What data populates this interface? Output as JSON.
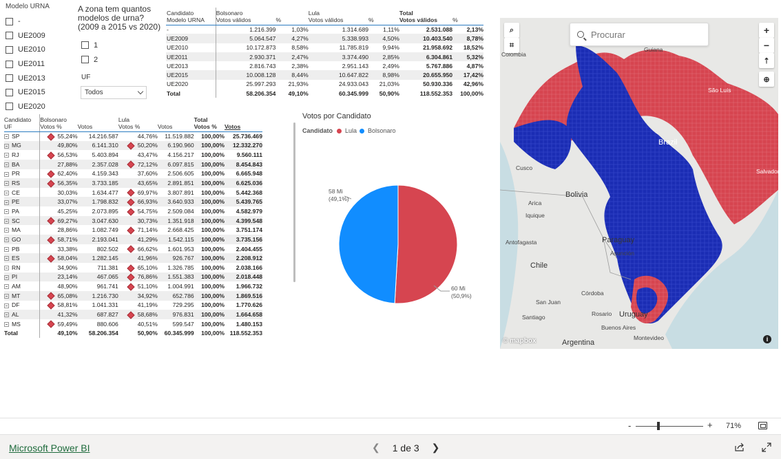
{
  "slicer_urna": {
    "title": "Modelo URNA",
    "options": [
      "-",
      "UE2009",
      "UE2010",
      "UE2011",
      "UE2013",
      "UE2015",
      "UE2020"
    ]
  },
  "slicer_zona": {
    "question": "A zona tem quantos modelos de urna? (2009 a 2015 vs 2020)",
    "options": [
      "1",
      "2"
    ],
    "uf_label": "UF",
    "uf_value": "Todos"
  },
  "table1": {
    "headers_row1": [
      "Candidato",
      "Bolsonaro",
      "",
      "Lula",
      "",
      "Total",
      ""
    ],
    "headers_row2": [
      "Modelo URNA",
      "Votos válidos",
      "%",
      "Votos válidos",
      "%",
      "Votos válidos",
      "%"
    ],
    "rows": [
      [
        "-",
        "1.216.399",
        "1,03%",
        "1.314.689",
        "1,11%",
        "2.531.088",
        "2,13%"
      ],
      [
        "UE2009",
        "5.064.547",
        "4,27%",
        "5.338.993",
        "4,50%",
        "10.403.540",
        "8,78%"
      ],
      [
        "UE2010",
        "10.172.873",
        "8,58%",
        "11.785.819",
        "9,94%",
        "21.958.692",
        "18,52%"
      ],
      [
        "UE2011",
        "2.930.371",
        "2,47%",
        "3.374.490",
        "2,85%",
        "6.304.861",
        "5,32%"
      ],
      [
        "UE2013",
        "2.816.743",
        "2,38%",
        "2.951.143",
        "2,49%",
        "5.767.886",
        "4,87%"
      ],
      [
        "UE2015",
        "10.008.128",
        "8,44%",
        "10.647.822",
        "8,98%",
        "20.655.950",
        "17,42%"
      ],
      [
        "UE2020",
        "25.997.293",
        "21,93%",
        "24.933.043",
        "21,03%",
        "50.930.336",
        "42,96%"
      ]
    ],
    "total": [
      "Total",
      "58.206.354",
      "49,10%",
      "60.345.999",
      "50,90%",
      "118.552.353",
      "100,00%"
    ]
  },
  "table2": {
    "headers_row1": [
      "Candidato",
      "Bolsonaro",
      "",
      "Lula",
      "",
      "Total",
      ""
    ],
    "headers_row2": [
      "UF",
      "Votos %",
      "Votos",
      "Votos %",
      "Votos",
      "Votos %",
      "Votos"
    ],
    "rows": [
      {
        "uf": "SP",
        "b_pct": "55,24%",
        "b_votos": "14.216.587",
        "l_pct": "44,76%",
        "l_votos": "11.519.882",
        "t_pct": "100,00%",
        "t_votos": "25.736.469",
        "win": "b"
      },
      {
        "uf": "MG",
        "b_pct": "49,80%",
        "b_votos": "6.141.310",
        "l_pct": "50,20%",
        "l_votos": "6.190.960",
        "t_pct": "100,00%",
        "t_votos": "12.332.270",
        "win": "l"
      },
      {
        "uf": "RJ",
        "b_pct": "56,53%",
        "b_votos": "5.403.894",
        "l_pct": "43,47%",
        "l_votos": "4.156.217",
        "t_pct": "100,00%",
        "t_votos": "9.560.111",
        "win": "b"
      },
      {
        "uf": "BA",
        "b_pct": "27,88%",
        "b_votos": "2.357.028",
        "l_pct": "72,12%",
        "l_votos": "6.097.815",
        "t_pct": "100,00%",
        "t_votos": "8.454.843",
        "win": "l"
      },
      {
        "uf": "PR",
        "b_pct": "62,40%",
        "b_votos": "4.159.343",
        "l_pct": "37,60%",
        "l_votos": "2.506.605",
        "t_pct": "100,00%",
        "t_votos": "6.665.948",
        "win": "b"
      },
      {
        "uf": "RS",
        "b_pct": "56,35%",
        "b_votos": "3.733.185",
        "l_pct": "43,65%",
        "l_votos": "2.891.851",
        "t_pct": "100,00%",
        "t_votos": "6.625.036",
        "win": "b"
      },
      {
        "uf": "CE",
        "b_pct": "30,03%",
        "b_votos": "1.634.477",
        "l_pct": "69,97%",
        "l_votos": "3.807.891",
        "t_pct": "100,00%",
        "t_votos": "5.442.368",
        "win": "l"
      },
      {
        "uf": "PE",
        "b_pct": "33,07%",
        "b_votos": "1.798.832",
        "l_pct": "66,93%",
        "l_votos": "3.640.933",
        "t_pct": "100,00%",
        "t_votos": "5.439.765",
        "win": "l"
      },
      {
        "uf": "PA",
        "b_pct": "45,25%",
        "b_votos": "2.073.895",
        "l_pct": "54,75%",
        "l_votos": "2.509.084",
        "t_pct": "100,00%",
        "t_votos": "4.582.979",
        "win": "l"
      },
      {
        "uf": "SC",
        "b_pct": "69,27%",
        "b_votos": "3.047.630",
        "l_pct": "30,73%",
        "l_votos": "1.351.918",
        "t_pct": "100,00%",
        "t_votos": "4.399.548",
        "win": "b"
      },
      {
        "uf": "MA",
        "b_pct": "28,86%",
        "b_votos": "1.082.749",
        "l_pct": "71,14%",
        "l_votos": "2.668.425",
        "t_pct": "100,00%",
        "t_votos": "3.751.174",
        "win": "l"
      },
      {
        "uf": "GO",
        "b_pct": "58,71%",
        "b_votos": "2.193.041",
        "l_pct": "41,29%",
        "l_votos": "1.542.115",
        "t_pct": "100,00%",
        "t_votos": "3.735.156",
        "win": "b"
      },
      {
        "uf": "PB",
        "b_pct": "33,38%",
        "b_votos": "802.502",
        "l_pct": "66,62%",
        "l_votos": "1.601.953",
        "t_pct": "100,00%",
        "t_votos": "2.404.455",
        "win": "l"
      },
      {
        "uf": "ES",
        "b_pct": "58,04%",
        "b_votos": "1.282.145",
        "l_pct": "41,96%",
        "l_votos": "926.767",
        "t_pct": "100,00%",
        "t_votos": "2.208.912",
        "win": "b"
      },
      {
        "uf": "RN",
        "b_pct": "34,90%",
        "b_votos": "711.381",
        "l_pct": "65,10%",
        "l_votos": "1.326.785",
        "t_pct": "100,00%",
        "t_votos": "2.038.166",
        "win": "l"
      },
      {
        "uf": "PI",
        "b_pct": "23,14%",
        "b_votos": "467.065",
        "l_pct": "76,86%",
        "l_votos": "1.551.383",
        "t_pct": "100,00%",
        "t_votos": "2.018.448",
        "win": "l"
      },
      {
        "uf": "AM",
        "b_pct": "48,90%",
        "b_votos": "961.741",
        "l_pct": "51,10%",
        "l_votos": "1.004.991",
        "t_pct": "100,00%",
        "t_votos": "1.966.732",
        "win": "l"
      },
      {
        "uf": "MT",
        "b_pct": "65,08%",
        "b_votos": "1.216.730",
        "l_pct": "34,92%",
        "l_votos": "652.786",
        "t_pct": "100,00%",
        "t_votos": "1.869.516",
        "win": "b"
      },
      {
        "uf": "DF",
        "b_pct": "58,81%",
        "b_votos": "1.041.331",
        "l_pct": "41,19%",
        "l_votos": "729.295",
        "t_pct": "100,00%",
        "t_votos": "1.770.626",
        "win": "b"
      },
      {
        "uf": "AL",
        "b_pct": "41,32%",
        "b_votos": "687.827",
        "l_pct": "58,68%",
        "l_votos": "976.831",
        "t_pct": "100,00%",
        "t_votos": "1.664.658",
        "win": "l"
      },
      {
        "uf": "MS",
        "b_pct": "59,49%",
        "b_votos": "880.606",
        "l_pct": "40,51%",
        "l_votos": "599.547",
        "t_pct": "100,00%",
        "t_votos": "1.480.153",
        "win": "b"
      }
    ],
    "total": {
      "uf": "Total",
      "b_pct": "49,10%",
      "b_votos": "58.206.354",
      "l_pct": "50,90%",
      "l_votos": "60.345.999",
      "t_pct": "100,00%",
      "t_votos": "118.552.353"
    }
  },
  "chart_data": {
    "type": "pie",
    "title": "Votos por Candidato",
    "legend_title": "Candidato",
    "legend_position": "top-left",
    "slices": [
      {
        "name": "Lula",
        "value": 60345999,
        "label": "60 Mi",
        "pct_label": "(50,9%)",
        "color": "#d64550"
      },
      {
        "name": "Bolsonaro",
        "value": 58206354,
        "label": "58 Mi",
        "pct_label": "(49,1%)",
        "color": "#118dff"
      }
    ]
  },
  "map": {
    "search_placeholder": "Procurar",
    "attribution": "mapbox",
    "labels": {
      "colombia": "Colombia",
      "guiana": "Guiana",
      "sao_luis": "São Luís",
      "brazil": "Brazil",
      "salvador": "Salvador",
      "cusco": "Cusco",
      "bolivia": "Bolivia",
      "arica": "Arica",
      "iquique": "Iquique",
      "antofagasta": "Antofagasta",
      "paraguay": "Paraguay",
      "asuncion": "Asunción",
      "chile": "Chile",
      "san_juan": "San Juan",
      "cordoba": "Córdoba",
      "rosario": "Rosario",
      "santiago": "Santiago",
      "buenos_aires": "Buenos Aires",
      "uruguay": "Uruguay",
      "montevideo": "Montevideo",
      "argentina": "Argentina"
    },
    "colors": {
      "lula": "#d64550",
      "bolsonaro": "#1b2db4"
    }
  },
  "zoom": {
    "minus": "-",
    "plus": "+",
    "percent": "71%",
    "level": 0.71
  },
  "footer": {
    "brand": "Microsoft Power BI",
    "page": "1 de 3"
  }
}
